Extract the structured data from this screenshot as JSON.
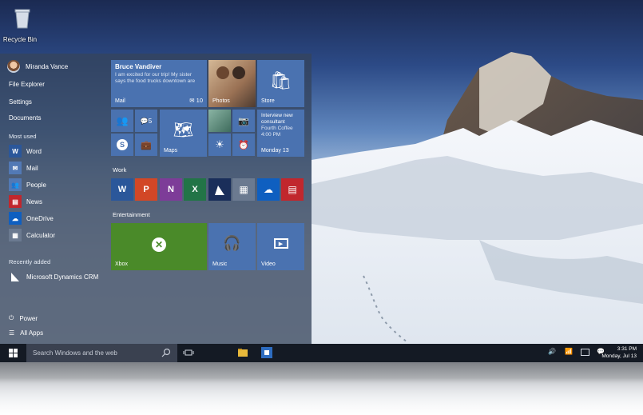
{
  "desktop": {
    "recycle_bin_label": "Recycle Bin"
  },
  "start_menu": {
    "user_name": "Miranda Vance",
    "links": {
      "file_explorer": "File Explorer",
      "settings": "Settings",
      "documents": "Documents"
    },
    "most_used_header": "Most used",
    "most_used": [
      {
        "label": "Word",
        "icon": "word-icon",
        "color": "#2b579a"
      },
      {
        "label": "Mail",
        "icon": "mail-icon",
        "color": "#5279b5"
      },
      {
        "label": "People",
        "icon": "people-icon",
        "color": "#5279b5"
      },
      {
        "label": "News",
        "icon": "news-icon",
        "color": "#c1272d"
      },
      {
        "label": "OneDrive",
        "icon": "onedrive-icon",
        "color": "#0f5fc0"
      },
      {
        "label": "Calculator",
        "icon": "calculator-icon",
        "color": "#6b7a90"
      }
    ],
    "recently_added_header": "Recently added",
    "recently_added": [
      {
        "label": "Microsoft Dynamics CRM",
        "icon": "dynamics-icon"
      }
    ],
    "power_label": "Power",
    "all_apps_label": "All Apps"
  },
  "tiles": {
    "mail": {
      "sender": "Bruce Vandiver",
      "preview": "I am excited for our trip! My sister says the food trucks downtown are",
      "label": "Mail",
      "count": "10"
    },
    "photos": {
      "label": "Photos"
    },
    "store": {
      "label": "Store"
    },
    "people_badge": "5",
    "maps": {
      "label": "Maps"
    },
    "calendar": {
      "line1": "Interview new",
      "line2": "consultant",
      "line3": "Fourth Coffee",
      "line4": "4:00 PM",
      "day": "Monday 13"
    },
    "work_header": "Work",
    "entertainment_header": "Entertainment",
    "xbox": {
      "label": "Xbox"
    },
    "music": {
      "label": "Music"
    },
    "video": {
      "label": "Video"
    }
  },
  "taskbar": {
    "search_placeholder": "Search Windows and the web",
    "time": "3:31 PM",
    "date": "Monday, Jul 13"
  },
  "colors": {
    "tile_blue": "#4a72b0",
    "xbox_green": "#4a8a29",
    "taskbar": "#141a24"
  }
}
